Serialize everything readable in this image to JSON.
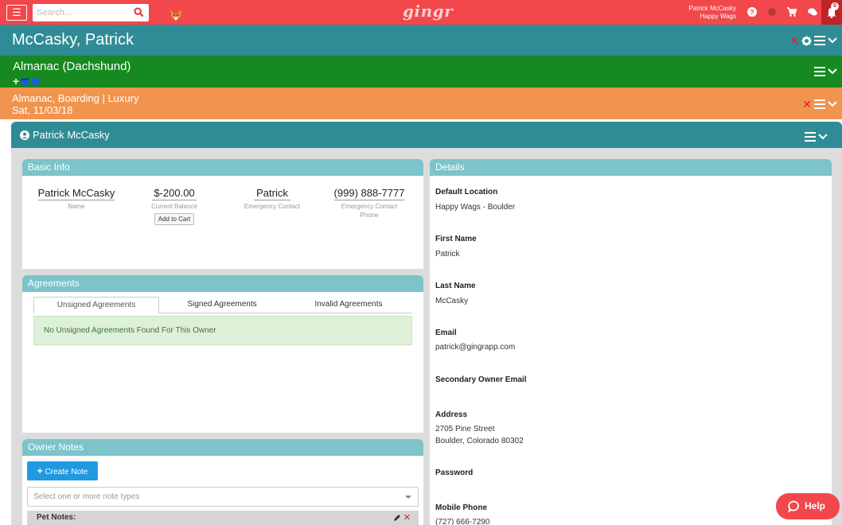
{
  "topbar": {
    "search_placeholder": "Search...",
    "logo": "gingr",
    "user_name": "Patrick McCasky",
    "location": "Happy Wags",
    "notification_count": "0",
    "colors": {
      "bar": "#f2474b",
      "bell_box": "#c02426"
    },
    "icons": [
      "menu-icon",
      "search-icon",
      "fox-icon",
      "question-icon",
      "status-dot-icon",
      "cart-icon",
      "chat-icon",
      "bell-icon"
    ]
  },
  "owner_band": {
    "title": "McCasky, Patrick",
    "color": "#2f8c96"
  },
  "pet_band": {
    "title": "Almanac (Dachshund)",
    "color": "#168a20"
  },
  "reservation_band": {
    "line1": "Almanac, Boarding | Luxury",
    "line2": "Sat, 11/03/18",
    "color": "#f0944e"
  },
  "panel": {
    "title": "Patrick McCasky"
  },
  "basic_info": {
    "title": "Basic Info",
    "name": {
      "value": "Patrick McCasky",
      "label": "Name"
    },
    "balance": {
      "value": "$-200.00",
      "label": "Current Balance",
      "button": "Add to Cart"
    },
    "emergency_contact": {
      "value": "Patrick",
      "label": "Emergency Contact"
    },
    "emergency_phone": {
      "value": "(999) 888-7777",
      "label_line1": "Emergency Contact",
      "label_line2": "Phone"
    }
  },
  "agreements": {
    "title": "Agreements",
    "tabs": [
      "Unsigned Agreements",
      "Signed Agreements",
      "Invalid Agreements"
    ],
    "message": "No Unsigned Agreements Found For This Owner"
  },
  "owner_notes": {
    "title": "Owner Notes",
    "create_button": "Create Note",
    "select_placeholder": "Select one or more note types",
    "pet_notes_label": "Pet Notes:"
  },
  "details": {
    "title": "Details",
    "fields": [
      {
        "label": "Default Location",
        "value": "Happy Wags - Boulder"
      },
      {
        "label": "First Name",
        "value": "Patrick"
      },
      {
        "label": "Last Name",
        "value": "McCasky"
      },
      {
        "label": "Email",
        "value": "patrick@gingrapp.com"
      },
      {
        "label": "Secondary Owner Email",
        "value": ""
      },
      {
        "label": "Address",
        "value": "2705 Pine Street",
        "value2": "Boulder, Colorado 80302"
      },
      {
        "label": "Password",
        "value": ""
      },
      {
        "label": "Mobile Phone",
        "value": "(727) 666-7290"
      }
    ]
  },
  "help_button": "Help"
}
